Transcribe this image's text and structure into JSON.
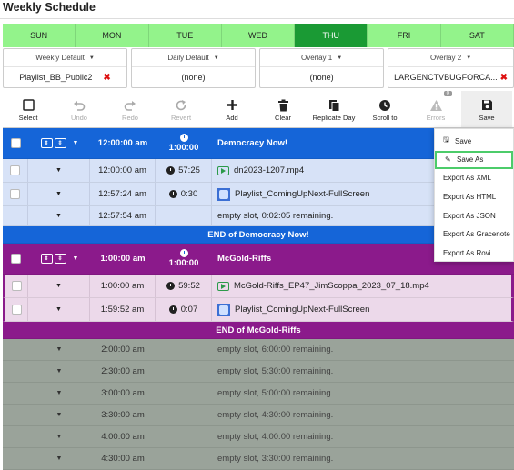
{
  "title": "Weekly Schedule",
  "days": [
    "SUN",
    "MON",
    "TUE",
    "WED",
    "THU",
    "FRI",
    "SAT"
  ],
  "active_day": "THU",
  "defaults": [
    {
      "label": "Weekly Default",
      "value": "Playlist_BB_Public2",
      "clearable": true
    },
    {
      "label": "Daily Default",
      "value": "(none)",
      "clearable": false
    },
    {
      "label": "Overlay 1",
      "value": "(none)",
      "clearable": false
    },
    {
      "label": "Overlay 2",
      "value": "LARGENCTVBUGFORCA...",
      "clearable": true
    }
  ],
  "toolbar": [
    {
      "label": "Select",
      "icon": "checkbox-icon",
      "enabled": true
    },
    {
      "label": "Undo",
      "icon": "undo-icon",
      "enabled": false
    },
    {
      "label": "Redo",
      "icon": "redo-icon",
      "enabled": false
    },
    {
      "label": "Revert",
      "icon": "revert-icon",
      "enabled": false
    },
    {
      "label": "Add",
      "icon": "plus-icon",
      "enabled": true
    },
    {
      "label": "Clear",
      "icon": "trash-icon",
      "enabled": true
    },
    {
      "label": "Replicate Day",
      "icon": "copy-icon",
      "enabled": true
    },
    {
      "label": "Scroll to",
      "icon": "clock-icon",
      "enabled": true
    },
    {
      "label": "Errors",
      "icon": "warning-icon",
      "enabled": false,
      "badge": "0"
    },
    {
      "label": "Save",
      "icon": "save-icon",
      "enabled": true
    }
  ],
  "blocks": [
    {
      "color": "blue",
      "start": "12:00:00 am",
      "duration": "1:00:00",
      "name": "Democracy Now!",
      "end_label": "END of Democracy Now!",
      "items": [
        {
          "time": "12:00:00 am",
          "duration": "57:25",
          "type": "video",
          "name": "dn2023-1207.mp4"
        },
        {
          "time": "12:57:24 am",
          "duration": "0:30",
          "type": "playlist",
          "name": "Playlist_ComingUpNext-FullScreen"
        },
        {
          "time": "12:57:54 am",
          "duration": "",
          "type": "empty",
          "name": "empty slot, 0:02:05 remaining."
        }
      ]
    },
    {
      "color": "purple",
      "start": "1:00:00 am",
      "duration": "1:00:00",
      "name": "McGold-Riffs",
      "end_label": "END of McGold-Riffs",
      "items": [
        {
          "time": "1:00:00 am",
          "duration": "59:52",
          "type": "video",
          "name": "McGold-Riffs_EP47_JimScoppa_2023_07_18.mp4"
        },
        {
          "time": "1:59:52 am",
          "duration": "0:07",
          "type": "playlist",
          "name": "Playlist_ComingUpNext-FullScreen"
        }
      ]
    }
  ],
  "empty_rows": [
    {
      "time": "2:00:00 am",
      "text": "empty slot, 6:00:00 remaining."
    },
    {
      "time": "2:30:00 am",
      "text": "empty slot, 5:30:00 remaining."
    },
    {
      "time": "3:00:00 am",
      "text": "empty slot, 5:00:00 remaining."
    },
    {
      "time": "3:30:00 am",
      "text": "empty slot, 4:30:00 remaining."
    },
    {
      "time": "4:00:00 am",
      "text": "empty slot, 4:00:00 remaining."
    },
    {
      "time": "4:30:00 am",
      "text": "empty slot, 3:30:00 remaining."
    }
  ],
  "save_menu": [
    {
      "label": "Save",
      "icon": "save-icon"
    },
    {
      "label": "Save As",
      "icon": "pencil-icon",
      "highlighted": true
    },
    {
      "label": "Export As XML",
      "icon": ""
    },
    {
      "label": "Export As HTML",
      "icon": ""
    },
    {
      "label": "Export As JSON",
      "icon": ""
    },
    {
      "label": "Export As Gracenote",
      "icon": ""
    },
    {
      "label": "Export As Rovi",
      "icon": ""
    }
  ]
}
